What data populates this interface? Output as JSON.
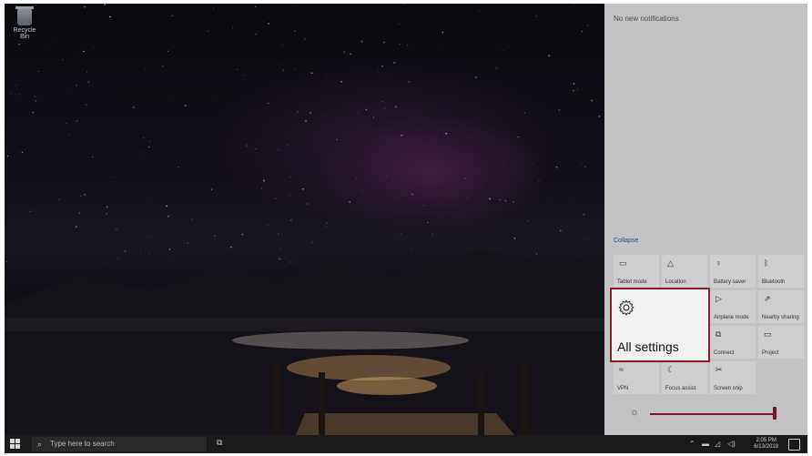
{
  "desktop": {
    "recycle_bin_label": "Recycle Bin"
  },
  "taskbar": {
    "search_placeholder": "Type here to search",
    "clock_time": "2:05 PM",
    "clock_date": "6/13/2019"
  },
  "action_center": {
    "no_notifications": "No new notifications",
    "collapse_label": "Collapse",
    "tiles": [
      {
        "label": "Tablet mode",
        "icon": "tablet-icon"
      },
      {
        "label": "Location",
        "icon": "location-icon"
      },
      {
        "label": "Battery saver",
        "icon": "battery-icon"
      },
      {
        "label": "Bluetooth",
        "icon": "bluetooth-icon"
      },
      {
        "label": "All settings",
        "icon": "gear-icon"
      },
      {
        "label": "Airplane mode",
        "icon": "airplane-icon"
      },
      {
        "label": "Nearby sharing",
        "icon": "share-icon"
      },
      {
        "label": "Connect",
        "icon": "connect-icon"
      },
      {
        "label": "Project",
        "icon": "project-icon"
      },
      {
        "label": "VPN",
        "icon": "vpn-icon"
      },
      {
        "label": "Focus assist",
        "icon": "moon-icon"
      },
      {
        "label": "Screen snip",
        "icon": "snip-icon"
      }
    ],
    "brightness_level": 1.0,
    "highlighted_tile_label": "All settings"
  },
  "colors": {
    "accent": "#8b1a2d",
    "action_center_bg": "#c3c3c5",
    "taskbar_bg": "#1a1a1c"
  }
}
